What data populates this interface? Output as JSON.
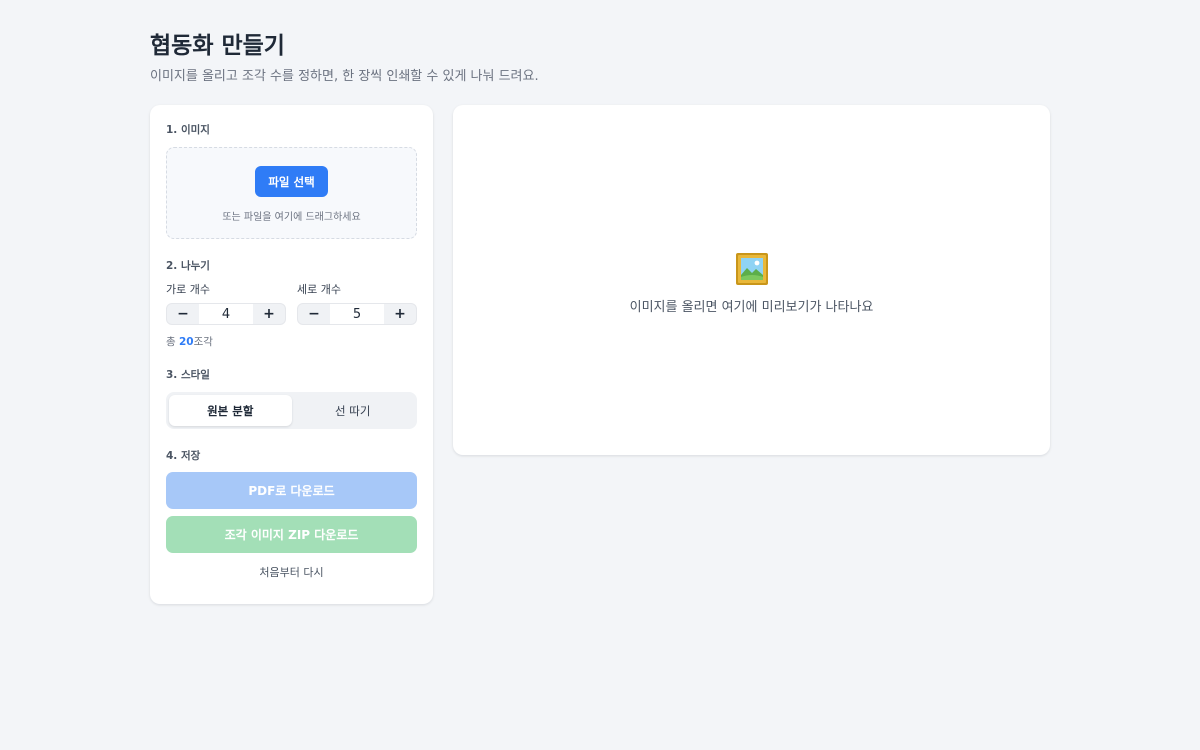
{
  "header": {
    "title": "협동화 만들기",
    "subtitle": "이미지를 올리고 조각 수를 정하면, 한 장씩 인쇄할 수 있게 나눠 드려요."
  },
  "sections": {
    "image": {
      "label": "1. 이미지",
      "file_button": "파일 선택",
      "drop_hint": "또는 파일을 여기에 드래그하세요"
    },
    "split": {
      "label": "2. 나누기",
      "columns_label": "가로 개수",
      "columns_value": "4",
      "rows_label": "세로 개수",
      "rows_value": "5",
      "minus": "−",
      "plus": "+",
      "total_prefix": "총 ",
      "total_count": "20",
      "total_suffix": "조각"
    },
    "style": {
      "label": "3. 스타일",
      "options": [
        "원본 분할",
        "선 따기"
      ],
      "selected": "원본 분할"
    },
    "save": {
      "label": "4. 저장",
      "pdf_button": "PDF로 다운로드",
      "zip_button": "조각 이미지 ZIP 다운로드",
      "reset_button": "처음부터 다시"
    }
  },
  "preview": {
    "icon": "framed-picture-icon",
    "hint": "이미지를 올리면 여기에 미리보기가 나타나요"
  },
  "colors": {
    "background": "#f3f5f8",
    "accent": "#2f7cf6",
    "pdf_disabled": "#a7c8f8",
    "zip_disabled": "#a3dfb7"
  }
}
